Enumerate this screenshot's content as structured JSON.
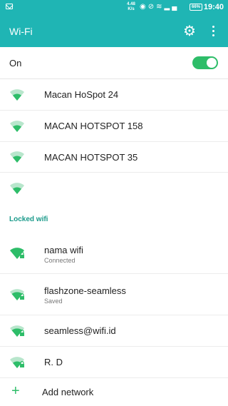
{
  "status_bar": {
    "speed_value": "4.48",
    "speed_unit": "K/s",
    "battery": "66%",
    "time": "19:40"
  },
  "app_bar": {
    "title": "Wi-Fi"
  },
  "wifi_switch": {
    "label": "On",
    "enabled": true
  },
  "open_networks": [
    {
      "name": "Macan HoSpot 24",
      "icon": "wifi-signal-icon"
    },
    {
      "name": "MACAN HOTSPOT 158",
      "icon": "wifi-signal-icon"
    },
    {
      "name": "MACAN HOTSPOT 35",
      "icon": "wifi-signal-icon"
    },
    {
      "name": "",
      "icon": "wifi-signal-icon"
    }
  ],
  "locked_section": {
    "title": "Locked wifi"
  },
  "locked_networks": [
    {
      "name": "nama wifi",
      "status": "Connected",
      "icon": "wifi-lock-icon"
    },
    {
      "name": "flashzone-seamless",
      "status": "Saved",
      "icon": "wifi-lock-icon"
    },
    {
      "name": "seamless@wifi.id",
      "status": "",
      "icon": "wifi-lock-icon"
    },
    {
      "name": "R. D",
      "status": "",
      "icon": "wifi-lock-icon"
    }
  ],
  "add_network": {
    "label": "Add network"
  },
  "colors": {
    "accent": "#1fb5b4",
    "toggle_on": "#2ebd69",
    "section_title": "#1a9a8a"
  }
}
